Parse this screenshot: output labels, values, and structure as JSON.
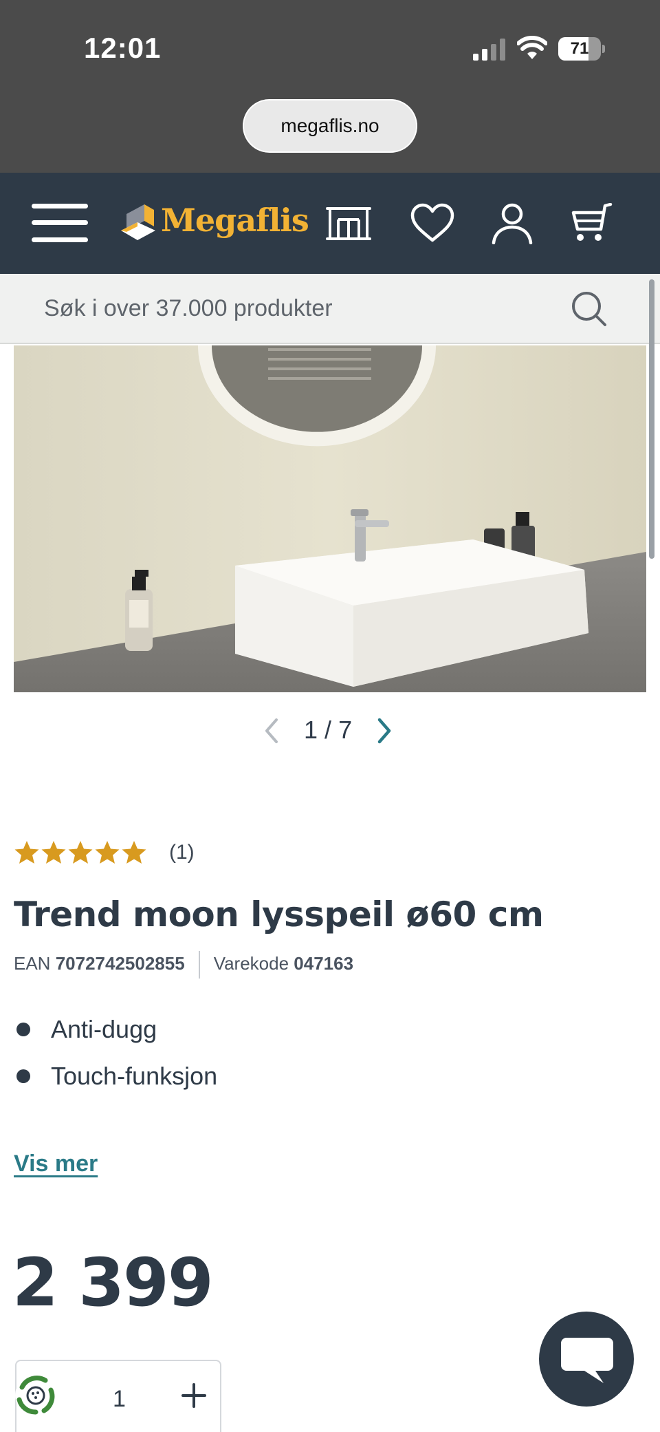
{
  "status_bar": {
    "time": "12:01",
    "battery_level": "71",
    "battery_fraction": 0.71
  },
  "browser": {
    "url": "megaflis.no"
  },
  "header": {
    "logo_text": "Megaflis",
    "brand_color": "#f2b234",
    "background_color": "#2e3a47",
    "icons": [
      "menu-icon",
      "store-icon",
      "heart-icon",
      "account-icon",
      "cart-icon"
    ]
  },
  "search": {
    "placeholder": "Søk i over 37.000 produkter"
  },
  "gallery": {
    "current": "1",
    "separator": "/",
    "total": "7"
  },
  "product": {
    "rating_value": 5,
    "rating_max": 5,
    "rating_count": "(1)",
    "title": "Trend moon lysspeil ø60 cm",
    "ean_label": "EAN",
    "ean_value": "7072742502855",
    "sku_label": "Varekode",
    "sku_value": "047163",
    "features": [
      "Anti-dugg",
      "Touch-funksjon"
    ],
    "show_more_label": "Vis mer",
    "price": "2 399",
    "quantity": "1"
  },
  "colors": {
    "accent_link": "#2a7a87",
    "star": "#d89a1f",
    "dark": "#2e3a47"
  }
}
